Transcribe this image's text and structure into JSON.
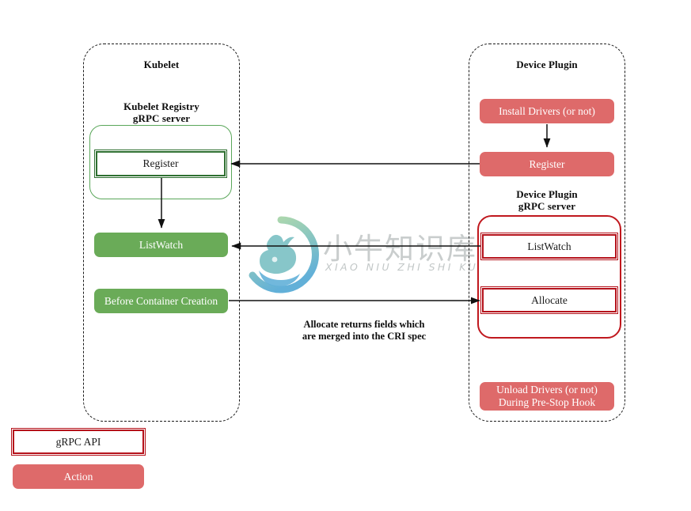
{
  "diagram": {
    "title_left": "Kubelet",
    "title_right": "Device Plugin",
    "left": {
      "container_label": "Kubelet",
      "registry_title_line1": "Kubelet Registry",
      "registry_title_line2": "gRPC server",
      "register_api": "Register",
      "listwatch_action": "ListWatch",
      "before_container_creation_action": "Before Container Creation"
    },
    "right": {
      "container_label": "Device Plugin",
      "install_drivers_action": "Install Drivers (or not)",
      "register_action": "Register",
      "grpc_title_line1": "Device Plugin",
      "grpc_title_line2": "gRPC server",
      "listwatch_api": "ListWatch",
      "allocate_api": "Allocate",
      "unload_drivers_line1": "Unload Drivers (or not)",
      "unload_drivers_line2": "During Pre-Stop Hook"
    },
    "annotation": {
      "line1": "Allocate returns fields which",
      "line2": "are merged into the CRI spec"
    },
    "legend": {
      "grpc_api_label": "gRPC API",
      "action_label": "Action"
    },
    "watermark": {
      "chinese": "小牛知识库",
      "pinyin": "XIAO NIU ZHI SHI KU"
    },
    "colors": {
      "action_green": "#6aab58",
      "action_red": "#de6a6a",
      "api_border_green": "#2f7031",
      "api_border_red": "#b5121b",
      "group_green": "#5aa75a",
      "group_red": "#c0181e",
      "dashed_border": "#1a1a1a",
      "arrow": "#111111"
    }
  }
}
